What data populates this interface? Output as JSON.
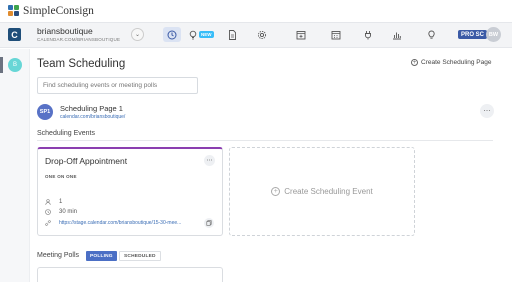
{
  "brand": {
    "name": "SimpleConsign"
  },
  "header": {
    "app_letter": "C",
    "account_name": "briansboutique",
    "account_url": "CALENDAR.COM/BRIANSBOUTIQUE",
    "new_badge": "NEW",
    "plan_badge": "PRO SC",
    "avatar_initials": "BW",
    "icons": [
      "clock-icon",
      "lightbulb-icon",
      "document-icon",
      "gear-icon",
      "calendar-add-icon",
      "calendar-icon",
      "plug-icon",
      "bar-chart-icon",
      "idea-icon"
    ]
  },
  "rail": {
    "dot_label": "B"
  },
  "main": {
    "title": "Team Scheduling",
    "create_page_label": "Create Scheduling Page",
    "search_placeholder": "Find scheduling events or meeting polls",
    "scheduling_page": {
      "badge": "SP1",
      "title": "Scheduling Page 1",
      "url": "calendar.com/briansboutique/"
    },
    "events_section_title": "Scheduling Events",
    "event": {
      "title": "Drop-Off Appointment",
      "type": "ONE ON ONE",
      "attendees": "1",
      "duration": "30 min",
      "link": "https://stage.calendar.com/briansboutique/15-30-mee..."
    },
    "create_event_label": "Create Scheduling Event",
    "polls_section_title": "Meeting Polls",
    "poll_tabs": [
      "POLLING",
      "SCHEDULED"
    ]
  },
  "colors": {
    "accent": "#4b6fc5",
    "event_top_border": "#8b3fb0",
    "new_badge": "#38bdf8",
    "rail_dot": "#67d6d6"
  }
}
